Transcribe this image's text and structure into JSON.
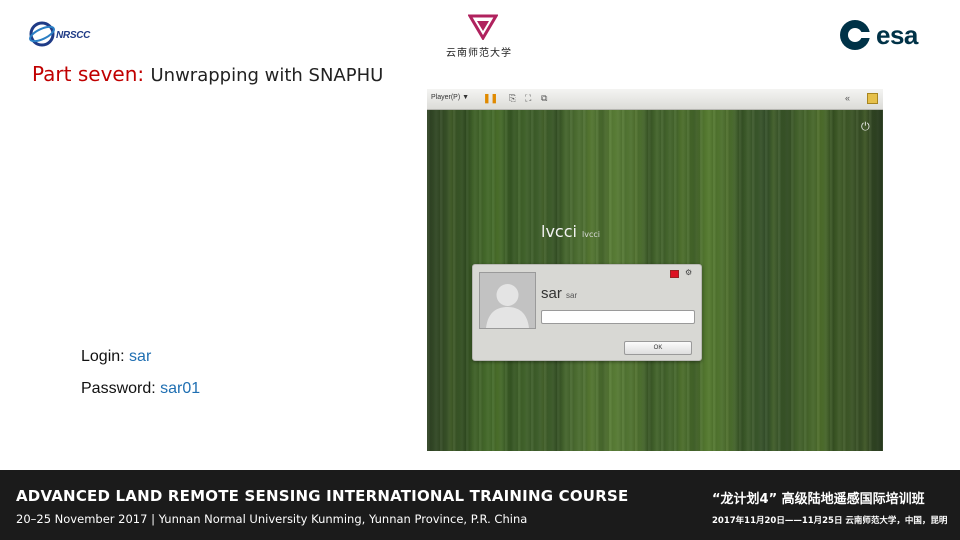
{
  "header": {
    "left_logo_text": "NRSCC",
    "center_logo_text": "云南师范大学",
    "right_logo_text": "esa"
  },
  "title": {
    "part": "Part seven:",
    "text": "Unwrapping with SNAPHU"
  },
  "credentials": {
    "login_label": "Login:",
    "login_value": "sar",
    "password_label": "Password:",
    "password_value": "sar01"
  },
  "vm": {
    "player_menu": "Player(P) ▼",
    "hostname": "lvcci",
    "hostname_small": "lvcci",
    "username": "sar",
    "username_small": "sar",
    "password_value": "",
    "ok_label": "OK"
  },
  "footer": {
    "course_title": "ADVANCED LAND REMOTE SENSING INTERNATIONAL TRAINING COURSE",
    "course_details": "20–25 November 2017 | Yunnan Normal University Kunming, Yunnan Province, P.R. China",
    "cn_title": "“龙计划4” 高级陆地遥感国际培训班",
    "cn_details": "2017年11月20日——11月25日   云南师范大学，中国，昆明"
  },
  "colors": {
    "title_red": "#c00000",
    "value_blue": "#1f6fb2",
    "footer_bg": "#1b1b1b",
    "esa_blue": "#003247"
  }
}
